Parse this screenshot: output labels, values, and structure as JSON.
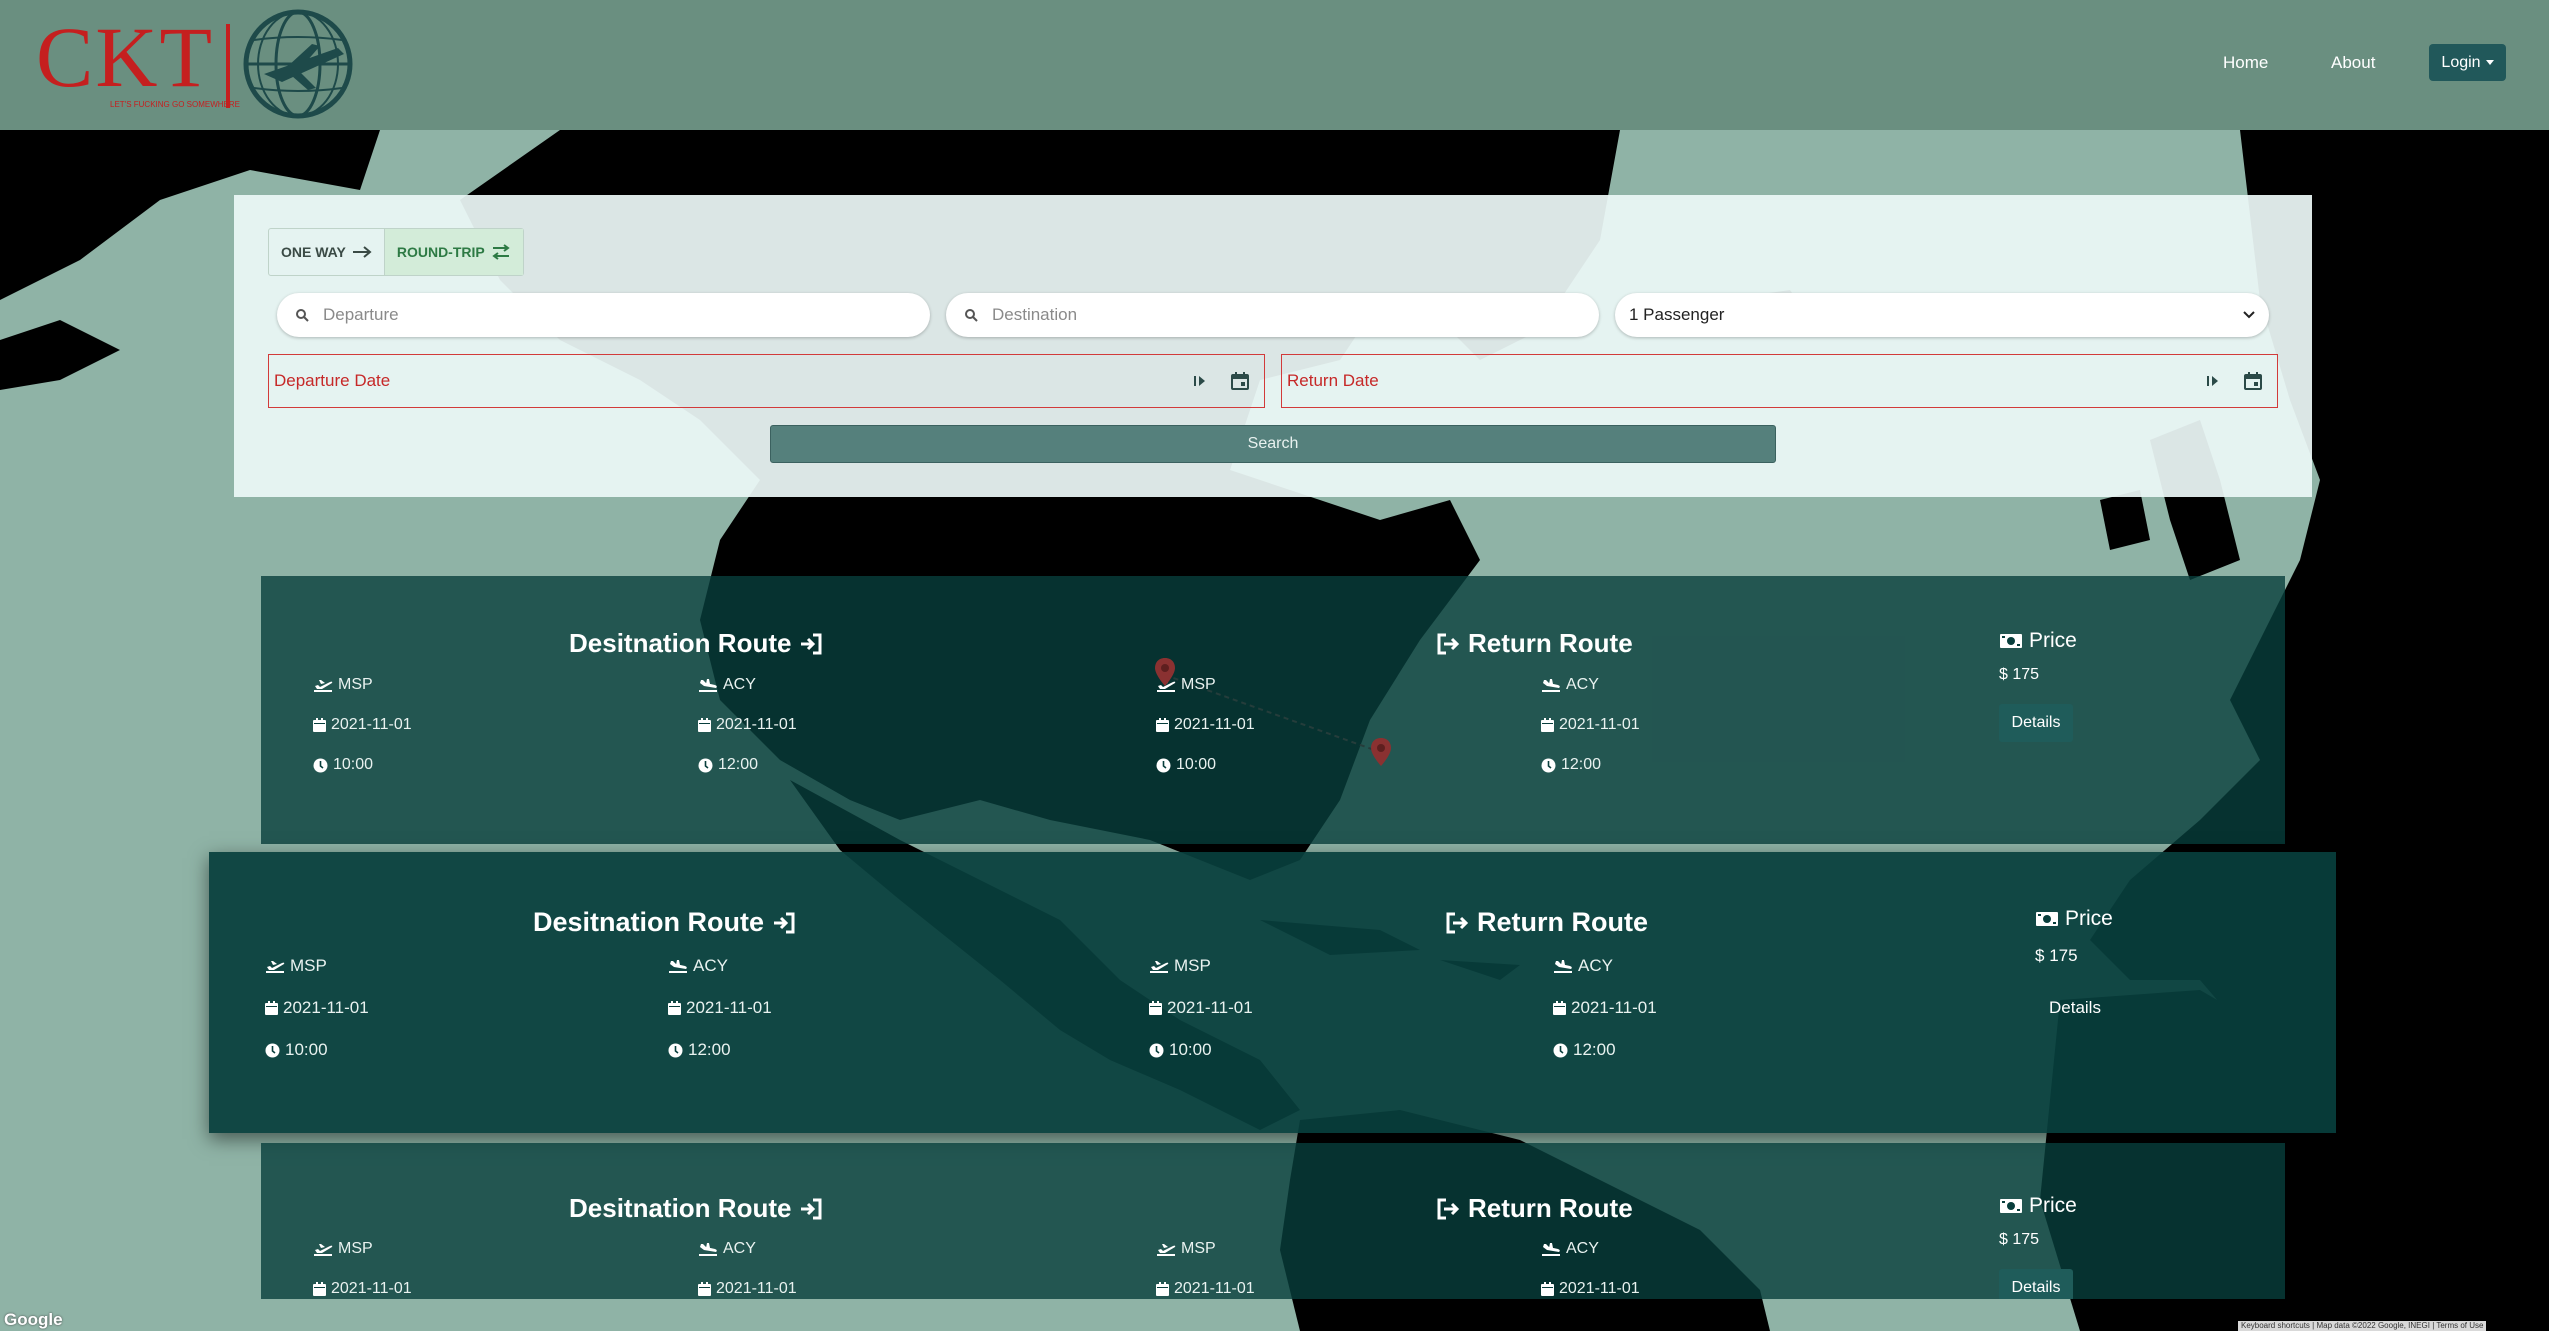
{
  "navbar": {
    "logo_text": "CKT",
    "logo_tagline": "LET'S FUCKING GO SOMEWHERE",
    "links": [
      {
        "label": "Home"
      },
      {
        "label": "About"
      }
    ],
    "login_label": "Login"
  },
  "search": {
    "trip_types": [
      {
        "label": "ONE WAY",
        "icon": "arrow-right-icon",
        "active": false
      },
      {
        "label": "ROUND-TRIP",
        "icon": "arrows-exchange-icon",
        "active": true
      }
    ],
    "departure_placeholder": "Departure",
    "destination_placeholder": "Destination",
    "passengers_value": "1 Passenger",
    "departure_date_label": "Departure Date",
    "return_date_label": "Return Date",
    "search_label": "Search"
  },
  "results": [
    {
      "dest_title": "Desitnation Route",
      "return_title": "Return Route",
      "outbound": {
        "from": "MSP",
        "to": "ACY",
        "from_date": "2021-11-01",
        "to_date": "2021-11-01",
        "dep_time": "10:00",
        "arr_time": "12:00"
      },
      "inbound": {
        "from": "MSP",
        "to": "ACY",
        "from_date": "2021-11-01",
        "to_date": "2021-11-01",
        "dep_time": "10:00",
        "arr_time": "12:00"
      },
      "price_label": "Price",
      "price": "175",
      "details_label": "Details"
    },
    {
      "dest_title": "Desitnation Route",
      "return_title": "Return Route",
      "outbound": {
        "from": "MSP",
        "to": "ACY",
        "from_date": "2021-11-01",
        "to_date": "2021-11-01",
        "dep_time": "10:00",
        "arr_time": "12:00"
      },
      "inbound": {
        "from": "MSP",
        "to": "ACY",
        "from_date": "2021-11-01",
        "to_date": "2021-11-01",
        "dep_time": "10:00",
        "arr_time": "12:00"
      },
      "price_label": "Price",
      "price": "175",
      "details_label": "Details"
    },
    {
      "dest_title": "Desitnation Route",
      "return_title": "Return Route",
      "outbound": {
        "from": "MSP",
        "to": "ACY",
        "from_date": "2021-11-01",
        "to_date": "2021-11-01"
      },
      "inbound": {
        "from": "MSP",
        "to": "ACY",
        "from_date": "2021-11-01",
        "to_date": "2021-11-01"
      },
      "price_label": "Price",
      "price": "175",
      "details_label": "Details"
    }
  ],
  "map": {
    "google_label": "Google",
    "attribution": "Keyboard shortcuts | Map data ©2022 Google, INEGI | Terms of Use"
  },
  "colors": {
    "navbar": "#6a8f80",
    "brand_red": "#c51f1f",
    "ocean": "#8fb3a6",
    "land": "#000000",
    "card": "#083e3c",
    "accent_button": "#21585a"
  }
}
